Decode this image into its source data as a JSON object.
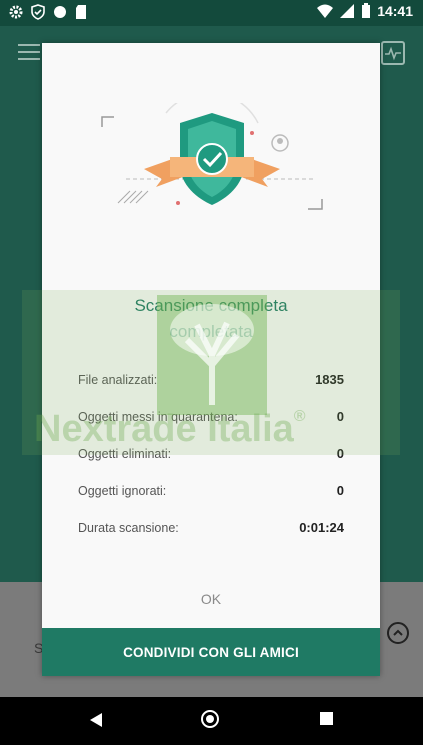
{
  "status_bar": {
    "time": "14:41",
    "left_icons": [
      "gear-icon",
      "shield-check-icon",
      "circle-icon",
      "sd-card-icon"
    ],
    "right_icons": [
      "wifi-icon",
      "signal-icon",
      "battery-icon"
    ]
  },
  "dialog": {
    "title_line1": "Scansione completa",
    "title_line2": "completata",
    "rows": [
      {
        "label": "File analizzati:",
        "value": "1835"
      },
      {
        "label": "Oggetti messi in quarantena:",
        "value": "0"
      },
      {
        "label": "Oggetti eliminati:",
        "value": "0"
      },
      {
        "label": "Oggetti ignorati:",
        "value": "0"
      },
      {
        "label": "Durata scansione:",
        "value": "0:01:24"
      }
    ],
    "ok_label": "OK",
    "share_label": "CONDIVIDI CON GLI AMICI"
  },
  "background": {
    "share_hint": "S"
  },
  "watermark": {
    "text": "Nextrade Italia",
    "reg": "®"
  },
  "colors": {
    "accent": "#1f7a64",
    "appbar": "#1f5a4c",
    "shield": "#f0a060"
  }
}
